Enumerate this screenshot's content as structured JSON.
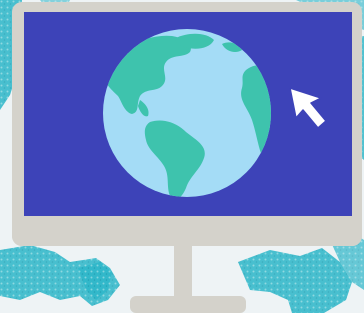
{
  "illustration": {
    "subject": "computer-monitor-with-globe",
    "icons": [
      "world-map-background",
      "monitor",
      "globe-icon",
      "mouse-cursor-icon",
      "monitor-stand"
    ],
    "colors": {
      "background": "#eef3f5",
      "map_land": "#2bb6c8",
      "map_land_light": "#7fd3dc",
      "monitor_frame": "#d4d2cb",
      "monitor_frame_shadow": "#c2c0b8",
      "screen": "#3d43b8",
      "globe_ocean": "#a4dcf6",
      "globe_land": "#3ec3ad",
      "cursor_fill": "#ffffff",
      "cursor_outline": "#3d43b8"
    }
  }
}
